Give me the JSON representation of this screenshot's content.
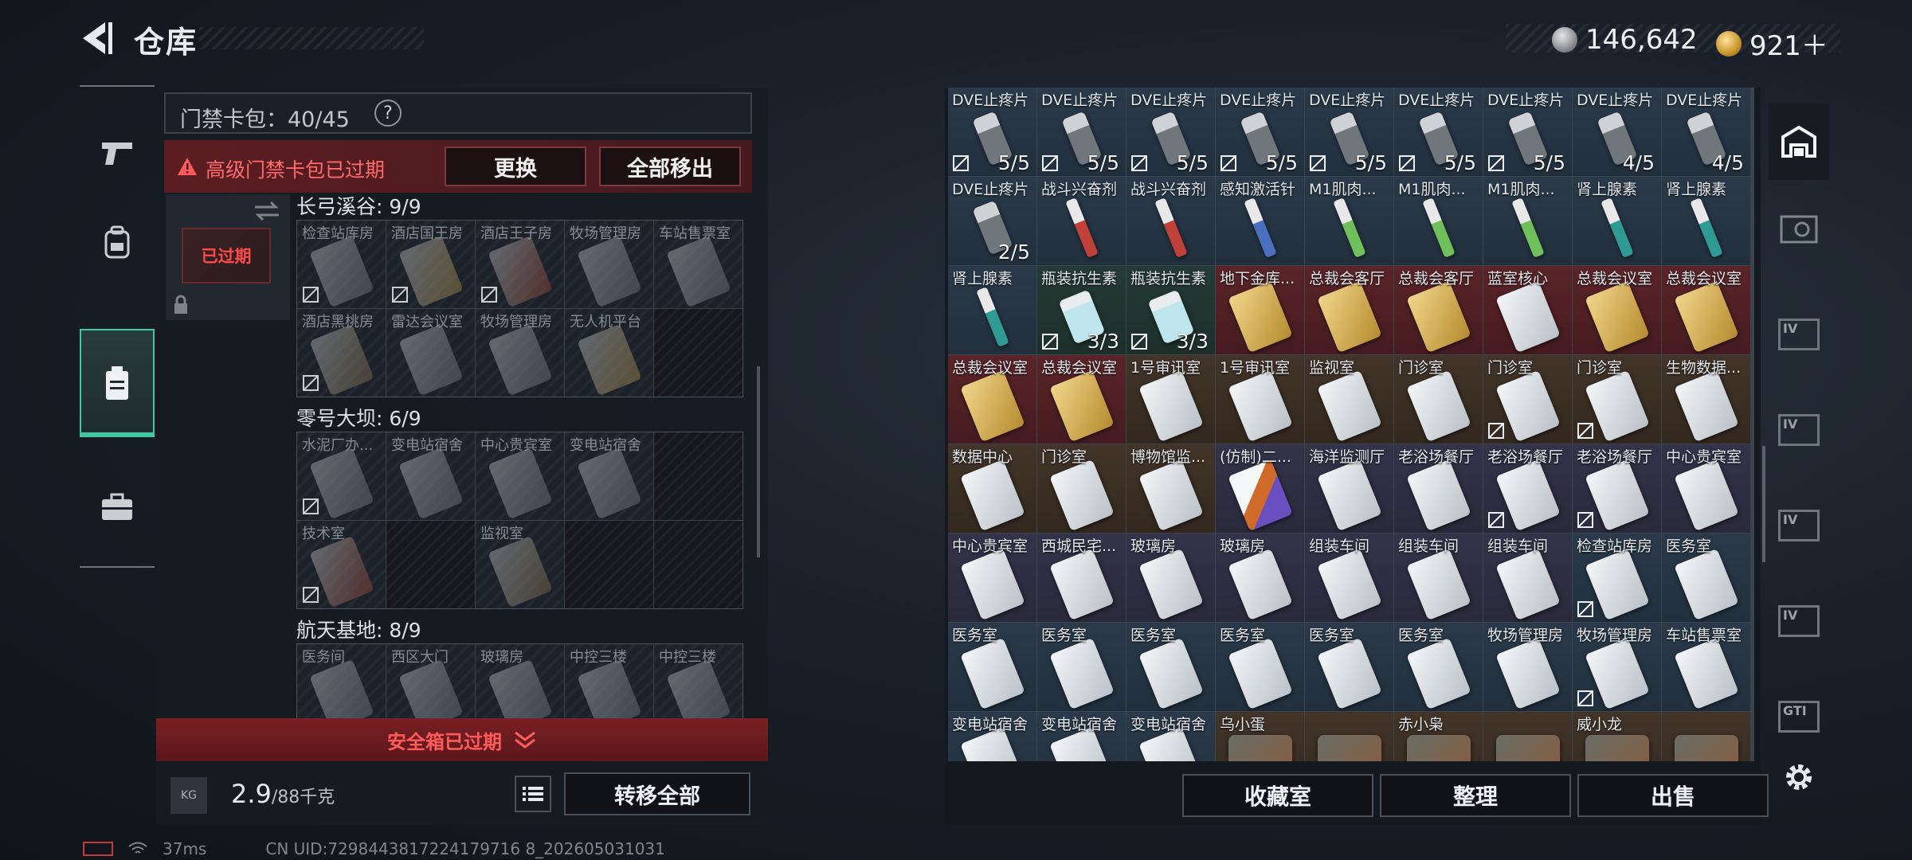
{
  "header": {
    "title": "仓库"
  },
  "currency": {
    "silver": "146,642",
    "gold": "921＋"
  },
  "left_rail": {
    "tabs": [
      "weapons",
      "gear",
      "storage",
      "briefcase"
    ],
    "active_index": 2
  },
  "cardpack": {
    "label": "门禁卡包：40/45",
    "help": "?",
    "expired_text": "高级门禁卡包已过期",
    "swap_label": "更换",
    "move_all_label": "全部移出",
    "slot_status": "已过期"
  },
  "maps": [
    {
      "title": "长弓溪谷: 9/9",
      "cells": [
        {
          "name": "检查站库房",
          "rarity": "gray",
          "locked": true
        },
        {
          "name": "酒店国王房",
          "rarity": "gold",
          "locked": true
        },
        {
          "name": "酒店王子房",
          "rarity": "red",
          "locked": true
        },
        {
          "name": "牧场管理房",
          "rarity": "gray",
          "locked": false
        },
        {
          "name": "车站售票室",
          "rarity": "gray",
          "locked": false
        },
        {
          "name": "酒店黑桃房",
          "rarity": "brown",
          "locked": true
        },
        {
          "name": "雷达会议室",
          "rarity": "gray",
          "locked": false
        },
        {
          "name": "牧场管理房",
          "rarity": "gray",
          "locked": false
        },
        {
          "name": "无人机平台",
          "rarity": "gold",
          "locked": false
        },
        {
          "name": "",
          "rarity": "empty",
          "locked": false
        }
      ]
    },
    {
      "title": "零号大坝: 6/9",
      "cells": [
        {
          "name": "水泥厂办...",
          "rarity": "gray",
          "locked": true
        },
        {
          "name": "变电站宿舍",
          "rarity": "gray",
          "locked": false
        },
        {
          "name": "中心贵宾室",
          "rarity": "gray",
          "locked": false
        },
        {
          "name": "变电站宿舍",
          "rarity": "gray",
          "locked": false
        },
        {
          "name": "",
          "rarity": "empty",
          "locked": false
        },
        {
          "name": "技术室",
          "rarity": "red",
          "locked": true
        },
        {
          "name": "",
          "rarity": "empty",
          "locked": false
        },
        {
          "name": "监视室",
          "rarity": "brown",
          "locked": false
        },
        {
          "name": "",
          "rarity": "empty",
          "locked": false
        },
        {
          "name": "",
          "rarity": "empty",
          "locked": false
        }
      ]
    },
    {
      "title": "航天基地: 8/9",
      "cells": [
        {
          "name": "医务间",
          "rarity": "gray",
          "locked": false
        },
        {
          "name": "西区大门",
          "rarity": "gray",
          "locked": false
        },
        {
          "name": "玻璃房",
          "rarity": "gray",
          "locked": false
        },
        {
          "name": "中控三楼",
          "rarity": "gray",
          "locked": false
        },
        {
          "name": "中控三楼",
          "rarity": "gray",
          "locked": false
        }
      ]
    }
  ],
  "safebox": {
    "label": "安全箱已过期"
  },
  "weight": {
    "current": "2.9",
    "max": "/88千克",
    "icon": "KG"
  },
  "transfer_all_label": "转移全部",
  "inventory": [
    {
      "name": "DVE止疼片",
      "count": "5/5",
      "locked": true,
      "rarity": "blue",
      "shape": "pill"
    },
    {
      "name": "DVE止疼片",
      "count": "5/5",
      "locked": true,
      "rarity": "blue",
      "shape": "pill"
    },
    {
      "name": "DVE止疼片",
      "count": "5/5",
      "locked": true,
      "rarity": "blue",
      "shape": "pill"
    },
    {
      "name": "DVE止疼片",
      "count": "5/5",
      "locked": true,
      "rarity": "blue",
      "shape": "pill"
    },
    {
      "name": "DVE止疼片",
      "count": "5/5",
      "locked": true,
      "rarity": "blue",
      "shape": "pill"
    },
    {
      "name": "DVE止疼片",
      "count": "5/5",
      "locked": true,
      "rarity": "blue",
      "shape": "pill"
    },
    {
      "name": "DVE止疼片",
      "count": "5/5",
      "locked": true,
      "rarity": "blue",
      "shape": "pill"
    },
    {
      "name": "DVE止疼片",
      "count": "4/5",
      "locked": false,
      "rarity": "blue",
      "shape": "pill"
    },
    {
      "name": "DVE止疼片",
      "count": "4/5",
      "locked": false,
      "rarity": "blue",
      "shape": "pill"
    },
    {
      "name": "DVE止疼片",
      "count": "2/5",
      "locked": false,
      "rarity": "blue",
      "shape": "pill"
    },
    {
      "name": "战斗兴奋剂",
      "count": "",
      "locked": false,
      "rarity": "blue",
      "shape": "syringe-red"
    },
    {
      "name": "战斗兴奋剂",
      "count": "",
      "locked": false,
      "rarity": "blue",
      "shape": "syringe-red"
    },
    {
      "name": "感知激活针",
      "count": "",
      "locked": false,
      "rarity": "blue",
      "shape": "syringe-blue"
    },
    {
      "name": "M1肌肉...",
      "count": "",
      "locked": false,
      "rarity": "blue",
      "shape": "syringe-green"
    },
    {
      "name": "M1肌肉...",
      "count": "",
      "locked": false,
      "rarity": "blue",
      "shape": "syringe-green"
    },
    {
      "name": "M1肌肉...",
      "count": "",
      "locked": false,
      "rarity": "blue",
      "shape": "syringe-green"
    },
    {
      "name": "肾上腺素",
      "count": "",
      "locked": false,
      "rarity": "blue",
      "shape": "syringe-teal"
    },
    {
      "name": "肾上腺素",
      "count": "",
      "locked": false,
      "rarity": "blue",
      "shape": "syringe-teal"
    },
    {
      "name": "肾上腺素",
      "count": "",
      "locked": false,
      "rarity": "blue",
      "shape": "syringe-teal"
    },
    {
      "name": "瓶装抗生素",
      "count": "3/3",
      "locked": true,
      "rarity": "green",
      "shape": "vial"
    },
    {
      "name": "瓶装抗生素",
      "count": "3/3",
      "locked": true,
      "rarity": "green",
      "shape": "vial"
    },
    {
      "name": "地下金库...",
      "count": "",
      "locked": false,
      "rarity": "red",
      "shape": "card-gold"
    },
    {
      "name": "总裁会客厅",
      "count": "",
      "locked": false,
      "rarity": "red",
      "shape": "card-gold"
    },
    {
      "name": "总裁会客厅",
      "count": "",
      "locked": false,
      "rarity": "red",
      "shape": "card-gold"
    },
    {
      "name": "蓝室核心",
      "count": "",
      "locked": false,
      "rarity": "red",
      "shape": "card-white"
    },
    {
      "name": "总裁会议室",
      "count": "",
      "locked": false,
      "rarity": "red",
      "shape": "card-gold"
    },
    {
      "name": "总裁会议室",
      "count": "",
      "locked": false,
      "rarity": "red",
      "shape": "card-gold"
    },
    {
      "name": "总裁会议室",
      "count": "",
      "locked": false,
      "rarity": "red",
      "shape": "card-gold"
    },
    {
      "name": "总裁会议室",
      "count": "",
      "locked": false,
      "rarity": "red",
      "shape": "card-gold"
    },
    {
      "name": "1号审讯室",
      "count": "",
      "locked": false,
      "rarity": "brown",
      "shape": "card-white"
    },
    {
      "name": "1号审讯室",
      "count": "",
      "locked": false,
      "rarity": "brown",
      "shape": "card-white"
    },
    {
      "name": "监视室",
      "count": "",
      "locked": false,
      "rarity": "brown",
      "shape": "card-white"
    },
    {
      "name": "门诊室",
      "count": "",
      "locked": false,
      "rarity": "brown",
      "shape": "card-white"
    },
    {
      "name": "门诊室",
      "count": "",
      "locked": true,
      "rarity": "brown",
      "shape": "card-white"
    },
    {
      "name": "门诊室",
      "count": "",
      "locked": true,
      "rarity": "brown",
      "shape": "card-white"
    },
    {
      "name": "生物数据...",
      "count": "",
      "locked": false,
      "rarity": "brown",
      "shape": "card-white"
    },
    {
      "name": "数据中心",
      "count": "",
      "locked": false,
      "rarity": "brown",
      "shape": "card-white"
    },
    {
      "name": "门诊室",
      "count": "",
      "locked": false,
      "rarity": "brown",
      "shape": "card-white"
    },
    {
      "name": "博物馆监...",
      "count": "",
      "locked": false,
      "rarity": "brown",
      "shape": "card-white"
    },
    {
      "name": "(仿制)二...",
      "count": "",
      "locked": false,
      "rarity": "purple",
      "shape": "card-purple"
    },
    {
      "name": "海洋监测厅",
      "count": "",
      "locked": false,
      "rarity": "purple",
      "shape": "card-white"
    },
    {
      "name": "老浴场餐厅",
      "count": "",
      "locked": false,
      "rarity": "purple",
      "shape": "card-white"
    },
    {
      "name": "老浴场餐厅",
      "count": "",
      "locked": true,
      "rarity": "purple",
      "shape": "card-white"
    },
    {
      "name": "老浴场餐厅",
      "count": "",
      "locked": true,
      "rarity": "purple",
      "shape": "card-white"
    },
    {
      "name": "中心贵宾室",
      "count": "",
      "locked": false,
      "rarity": "purple",
      "shape": "card-white"
    },
    {
      "name": "中心贵宾室",
      "count": "",
      "locked": false,
      "rarity": "purple",
      "shape": "card-white"
    },
    {
      "name": "西城民宅...",
      "count": "",
      "locked": false,
      "rarity": "purple",
      "shape": "card-white"
    },
    {
      "name": "玻璃房",
      "count": "",
      "locked": false,
      "rarity": "purple",
      "shape": "card-white"
    },
    {
      "name": "玻璃房",
      "count": "",
      "locked": false,
      "rarity": "purple",
      "shape": "card-white"
    },
    {
      "name": "组装车间",
      "count": "",
      "locked": false,
      "rarity": "purple",
      "shape": "card-white"
    },
    {
      "name": "组装车间",
      "count": "",
      "locked": false,
      "rarity": "purple",
      "shape": "card-white"
    },
    {
      "name": "组装车间",
      "count": "",
      "locked": false,
      "rarity": "purple",
      "shape": "card-white"
    },
    {
      "name": "检查站库房",
      "count": "",
      "locked": true,
      "rarity": "blue",
      "shape": "card-white"
    },
    {
      "name": "医务室",
      "count": "",
      "locked": false,
      "rarity": "blue",
      "shape": "card-white"
    },
    {
      "name": "医务室",
      "count": "",
      "locked": false,
      "rarity": "blue",
      "shape": "card-white"
    },
    {
      "name": "医务室",
      "count": "",
      "locked": false,
      "rarity": "blue",
      "shape": "card-white"
    },
    {
      "name": "医务室",
      "count": "",
      "locked": false,
      "rarity": "blue",
      "shape": "card-white"
    },
    {
      "name": "医务室",
      "count": "",
      "locked": false,
      "rarity": "blue",
      "shape": "card-white"
    },
    {
      "name": "医务室",
      "count": "",
      "locked": false,
      "rarity": "blue",
      "shape": "card-white"
    },
    {
      "name": "医务室",
      "count": "",
      "locked": false,
      "rarity": "blue",
      "shape": "card-white"
    },
    {
      "name": "牧场管理房",
      "count": "",
      "locked": false,
      "rarity": "blue",
      "shape": "card-white"
    },
    {
      "name": "牧场管理房",
      "count": "",
      "locked": true,
      "rarity": "blue",
      "shape": "card-white"
    },
    {
      "name": "车站售票室",
      "count": "",
      "locked": false,
      "rarity": "blue",
      "shape": "card-white"
    },
    {
      "name": "变电站宿舍",
      "count": "",
      "locked": false,
      "rarity": "blue",
      "shape": "card-white"
    },
    {
      "name": "变电站宿舍",
      "count": "",
      "locked": false,
      "rarity": "blue",
      "shape": "card-white"
    },
    {
      "name": "变电站宿舍",
      "count": "",
      "locked": false,
      "rarity": "blue",
      "shape": "card-white"
    },
    {
      "name": "乌小蛋",
      "count": "",
      "locked": false,
      "rarity": "brown",
      "shape": "bot"
    },
    {
      "name": "",
      "count": "",
      "locked": false,
      "rarity": "brown",
      "shape": "bot"
    },
    {
      "name": "赤小枭",
      "count": "",
      "locked": false,
      "rarity": "brown",
      "shape": "bot"
    },
    {
      "name": "",
      "count": "",
      "locked": false,
      "rarity": "brown",
      "shape": "bot"
    },
    {
      "name": "威小龙",
      "count": "",
      "locked": false,
      "rarity": "brown",
      "shape": "bot"
    },
    {
      "name": "",
      "count": "",
      "locked": false,
      "rarity": "brown",
      "shape": "bot"
    }
  ],
  "right_footer": {
    "collection_label": "收藏室",
    "sort_label": "整理",
    "sell_label": "出售"
  },
  "right_rail": [
    "IV",
    "IV",
    "IV",
    "IV",
    "GTI"
  ],
  "status": {
    "ping": "37ms",
    "uid": "CN UID:7298443817224179716 8_202605031031"
  },
  "colors": {
    "accent_green": "#3ec9a0",
    "warn_red": "#ff5b5b",
    "expired_bg": "#5b1d22"
  }
}
